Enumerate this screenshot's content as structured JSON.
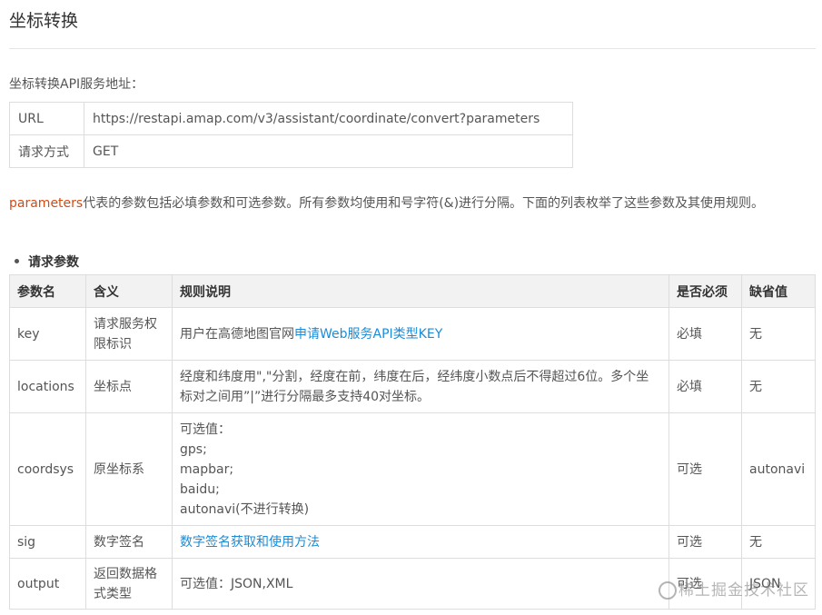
{
  "page": {
    "title": "坐标转换"
  },
  "service": {
    "caption": "坐标转换API服务地址：",
    "rows": [
      {
        "key": "URL",
        "value": "https://restapi.amap.com/v3/assistant/coordinate/convert?parameters"
      },
      {
        "key": "请求方式",
        "value": "GET"
      }
    ]
  },
  "intro": {
    "highlight": "parameters",
    "text": "代表的参数包括必填参数和可选参数。所有参数均使用和号字符(&)进行分隔。下面的列表枚举了这些参数及其使用规则。"
  },
  "params_section": {
    "title": "请求参数"
  },
  "params_table": {
    "headers": [
      "参数名",
      "含义",
      "规则说明",
      "是否必须",
      "缺省值"
    ],
    "rows": [
      {
        "name": "key",
        "meaning": "请求服务权限标识",
        "rule_prefix": "用户在高德地图官网",
        "rule_link": "申请Web服务API类型KEY",
        "required": "必填",
        "default": "无"
      },
      {
        "name": "locations",
        "meaning": "坐标点",
        "rule": "经度和纬度用\",\"分割，经度在前，纬度在后，经纬度小数点后不得超过6位。多个坐标对之间用”|”进行分隔最多支持40对坐标。",
        "required": "必填",
        "default": "无"
      },
      {
        "name": "coordsys",
        "meaning": "原坐标系",
        "rule_lines": [
          "可选值：",
          "gps;",
          "mapbar;",
          "baidu;",
          "autonavi(不进行转换)"
        ],
        "required": "可选",
        "default": "autonavi"
      },
      {
        "name": "sig",
        "meaning": "数字签名",
        "rule_link": "数字签名获取和使用方法",
        "required": "可选",
        "default": "无"
      },
      {
        "name": "output",
        "meaning": "返回数据格式类型",
        "rule": "可选值：JSON,XML",
        "required": "可选",
        "default": "JSON"
      }
    ]
  },
  "watermark": {
    "text": "稀土掘金技术社区"
  },
  "colors": {
    "highlight": "#d9480f",
    "link": "#1a8cd8",
    "border": "#dddddd",
    "header_bg": "#f2f2f2"
  }
}
